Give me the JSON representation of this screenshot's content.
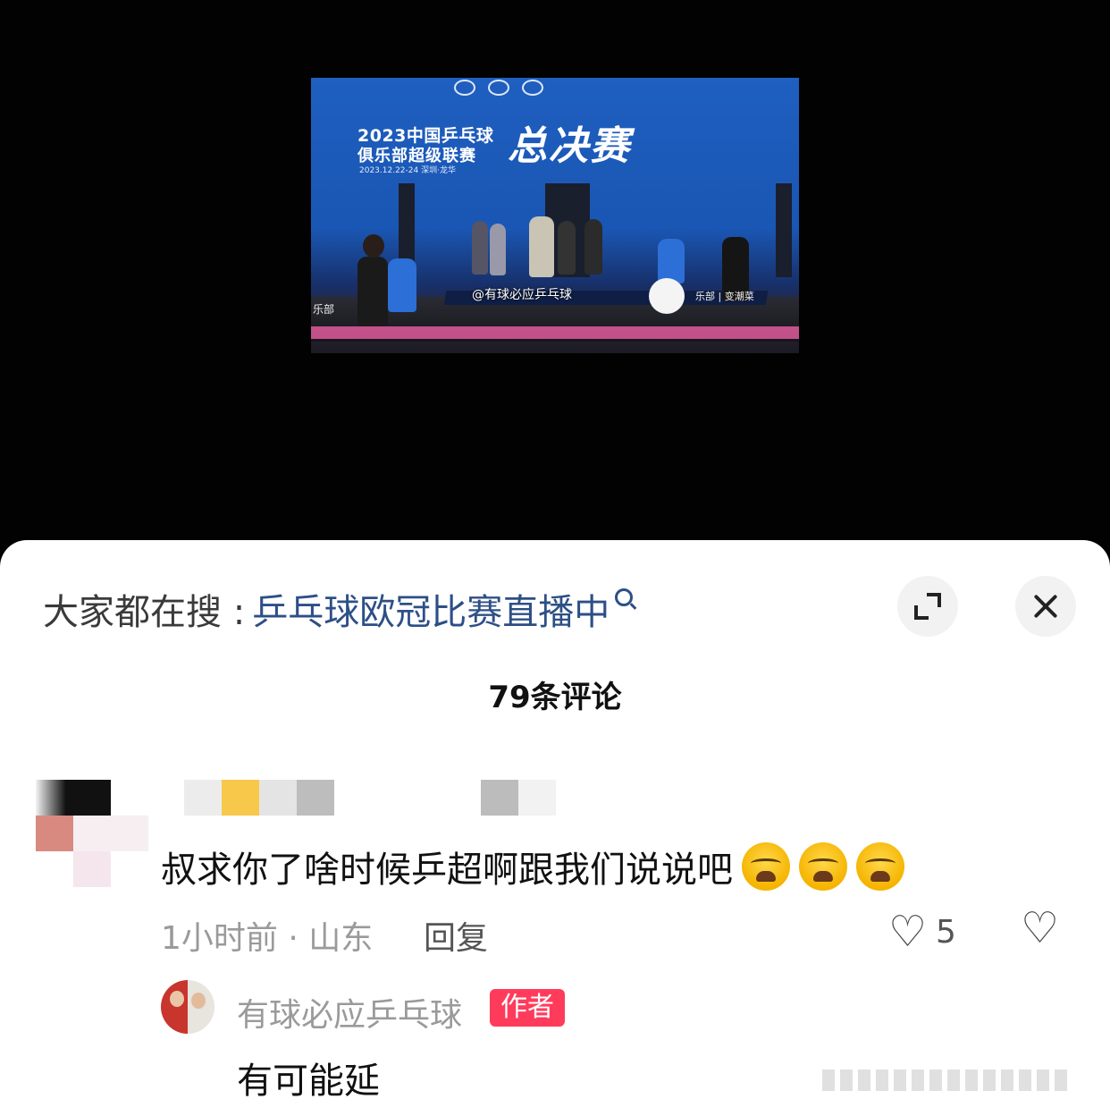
{
  "video": {
    "banner_line1": "2023中国乒乓球",
    "banner_line2": "俱乐部超级联赛",
    "banner_date": "2023.12.22-24 深圳·龙华",
    "banner_big": "总决赛",
    "watermark": "@有球必应乒乓球",
    "side_left": "乐部",
    "side_right": "乐部 | 变潮菜"
  },
  "search": {
    "prefix": "大家都在搜 :",
    "query": "乒乓球欧冠比赛直播中"
  },
  "comments_header": "79条评论",
  "comment": {
    "text": "叔求你了啥时候乒超啊跟我们说说吧",
    "emojis": [
      "crying-face",
      "crying-face",
      "crying-face"
    ],
    "meta": "1小时前 · 山东",
    "reply_label": "回复",
    "like_count": "5"
  },
  "reply": {
    "author": "有球必应乒乓球",
    "badge": "作者",
    "text": "有可能延"
  },
  "colors": {
    "link": "#2d4f86",
    "badge": "#ff3b5c",
    "muted": "#9a9a9a"
  }
}
